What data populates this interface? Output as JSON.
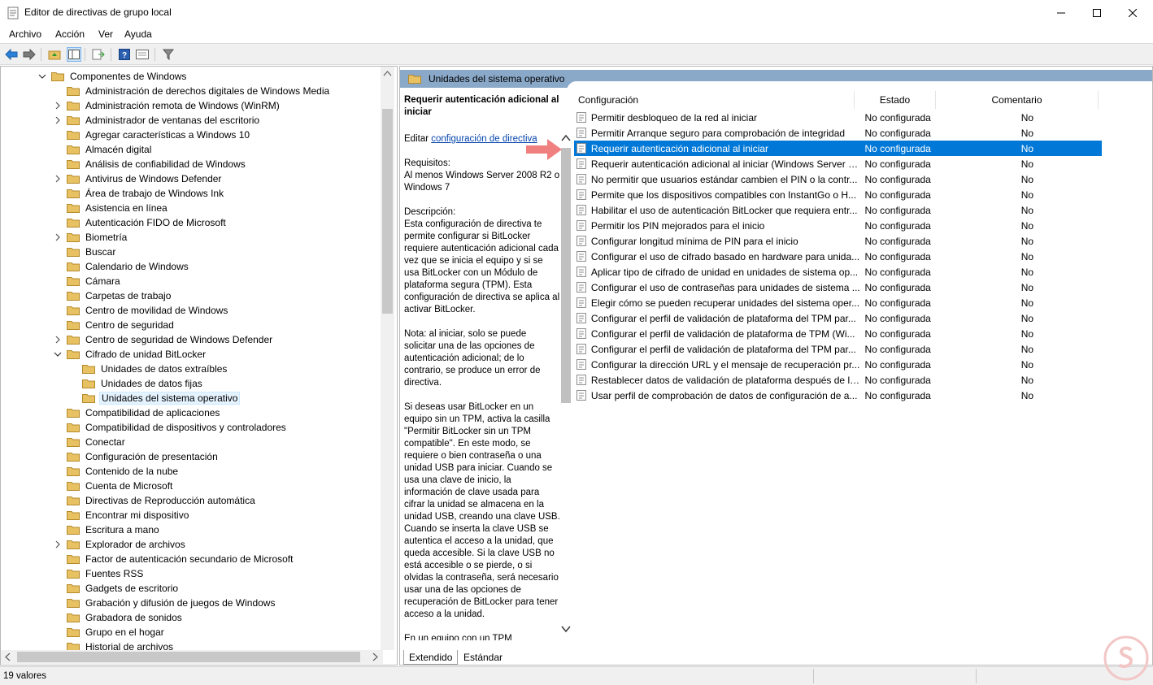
{
  "window": {
    "title": "Editor de directivas de grupo local"
  },
  "menu": [
    "Archivo",
    "Acción",
    "Ver",
    "Ayuda"
  ],
  "tree": {
    "root": "Componentes de Windows",
    "items": [
      {
        "label": "Administración de derechos digitales de Windows Media",
        "expander": ""
      },
      {
        "label": "Administración remota de Windows (WinRM)",
        "expander": "collapsed"
      },
      {
        "label": "Administrador de ventanas del escritorio",
        "expander": "collapsed"
      },
      {
        "label": "Agregar características a Windows 10",
        "expander": ""
      },
      {
        "label": "Almacén digital",
        "expander": ""
      },
      {
        "label": "Análisis de confiabilidad de Windows",
        "expander": ""
      },
      {
        "label": "Antivirus de Windows Defender",
        "expander": "collapsed"
      },
      {
        "label": "Área de trabajo de Windows Ink",
        "expander": ""
      },
      {
        "label": "Asistencia en línea",
        "expander": ""
      },
      {
        "label": "Autenticación FIDO de Microsoft",
        "expander": ""
      },
      {
        "label": "Biometría",
        "expander": "collapsed"
      },
      {
        "label": "Buscar",
        "expander": ""
      },
      {
        "label": "Calendario de Windows",
        "expander": ""
      },
      {
        "label": "Cámara",
        "expander": ""
      },
      {
        "label": "Carpetas de trabajo",
        "expander": ""
      },
      {
        "label": "Centro de movilidad de Windows",
        "expander": ""
      },
      {
        "label": "Centro de seguridad",
        "expander": ""
      },
      {
        "label": "Centro de seguridad de Windows Defender",
        "expander": "collapsed"
      },
      {
        "label": "Cifrado de unidad BitLocker",
        "expander": "expanded"
      },
      {
        "label": "Unidades de datos extraíbles",
        "expander": "",
        "child": true
      },
      {
        "label": "Unidades de datos fijas",
        "expander": "",
        "child": true
      },
      {
        "label": "Unidades del sistema operativo",
        "expander": "",
        "child": true,
        "selected": true
      },
      {
        "label": "Compatibilidad de aplicaciones",
        "expander": ""
      },
      {
        "label": "Compatibilidad de dispositivos y controladores",
        "expander": ""
      },
      {
        "label": "Conectar",
        "expander": ""
      },
      {
        "label": "Configuración de presentación",
        "expander": ""
      },
      {
        "label": "Contenido de la nube",
        "expander": ""
      },
      {
        "label": "Cuenta de Microsoft",
        "expander": ""
      },
      {
        "label": "Directivas de Reproducción automática",
        "expander": ""
      },
      {
        "label": "Encontrar mi dispositivo",
        "expander": ""
      },
      {
        "label": "Escritura a mano",
        "expander": ""
      },
      {
        "label": "Explorador de archivos",
        "expander": "collapsed"
      },
      {
        "label": "Factor de autenticación secundario de Microsoft",
        "expander": ""
      },
      {
        "label": "Fuentes RSS",
        "expander": ""
      },
      {
        "label": "Gadgets de escritorio",
        "expander": ""
      },
      {
        "label": "Grabación y difusión de juegos de Windows",
        "expander": ""
      },
      {
        "label": "Grabadora de sonidos",
        "expander": ""
      },
      {
        "label": "Grupo en el hogar",
        "expander": ""
      },
      {
        "label": "Historial de archivos",
        "expander": ""
      }
    ]
  },
  "right": {
    "header": "Unidades del sistema operativo",
    "description": {
      "title": "Requerir autenticación adicional al iniciar",
      "edit_prefix": "Editar ",
      "edit_link": "configuración de directiva",
      "requirements": "Requisitos:\nAl menos Windows Server 2008 R2 o Windows 7",
      "description": "Descripción:\nEsta configuración de directiva te permite configurar si BitLocker requiere autenticación adicional cada vez que se inicia el equipo y si se usa BitLocker con un Módulo de plataforma segura (TPM). Esta configuración de directiva se aplica al activar BitLocker.",
      "note": "Nota: al iniciar, solo se puede solicitar una de las opciones de autenticación adicional; de lo contrario, se produce un error de directiva.",
      "usb": "Si deseas usar BitLocker en un equipo sin un TPM, activa la casilla \"Permitir BitLocker sin un TPM compatible\". En este modo, se requiere o bien contraseña o una unidad USB para iniciar. Cuando se usa una clave de inicio, la información de clave usada para cifrar la unidad se almacena en la unidad USB, creando una clave USB. Cuando se inserta la clave USB se autentica el acceso a la unidad, que queda accesible. Si la clave USB no está accesible o se pierde, o si olvidas la contraseña, será necesario usar una de las opciones de recuperación de BitLocker para tener acceso a la unidad.",
      "tail": "En un equipo con un TPM"
    },
    "columns": [
      "Configuración",
      "Estado",
      "Comentario"
    ],
    "rows": [
      {
        "name": "Permitir desbloqueo de la red al iniciar",
        "state": "No configurada",
        "comment": "No"
      },
      {
        "name": "Permitir Arranque seguro para comprobación de integridad",
        "state": "No configurada",
        "comment": "No"
      },
      {
        "name": "Requerir autenticación adicional al iniciar",
        "state": "No configurada",
        "comment": "No",
        "selected": true
      },
      {
        "name": "Requerir autenticación adicional al iniciar (Windows Server 2...",
        "state": "No configurada",
        "comment": "No"
      },
      {
        "name": "No permitir que usuarios estándar cambien el PIN o la contr...",
        "state": "No configurada",
        "comment": "No"
      },
      {
        "name": "Permite que los dispositivos compatibles con InstantGo o H...",
        "state": "No configurada",
        "comment": "No"
      },
      {
        "name": "Habilitar el uso de autenticación BitLocker que requiera entr...",
        "state": "No configurada",
        "comment": "No"
      },
      {
        "name": "Permitir los PIN mejorados para el inicio",
        "state": "No configurada",
        "comment": "No"
      },
      {
        "name": "Configurar longitud mínima de PIN para el inicio",
        "state": "No configurada",
        "comment": "No"
      },
      {
        "name": "Configurar el uso de cifrado basado en hardware para unida...",
        "state": "No configurada",
        "comment": "No"
      },
      {
        "name": "Aplicar tipo de cifrado de unidad en unidades de sistema op...",
        "state": "No configurada",
        "comment": "No"
      },
      {
        "name": "Configurar el uso de contraseñas para unidades de sistema ...",
        "state": "No configurada",
        "comment": "No"
      },
      {
        "name": "Elegir cómo se pueden recuperar unidades del sistema oper...",
        "state": "No configurada",
        "comment": "No"
      },
      {
        "name": "Configurar el perfil de validación de plataforma del TPM par...",
        "state": "No configurada",
        "comment": "No"
      },
      {
        "name": "Configurar el perfil de validación de plataforma de TPM (Wi...",
        "state": "No configurada",
        "comment": "No"
      },
      {
        "name": "Configurar el perfil de validación de plataforma del TPM par...",
        "state": "No configurada",
        "comment": "No"
      },
      {
        "name": "Configurar la dirección URL y el mensaje de recuperación pr...",
        "state": "No configurada",
        "comment": "No"
      },
      {
        "name": "Restablecer datos de validación de plataforma después de la...",
        "state": "No configurada",
        "comment": "No"
      },
      {
        "name": "Usar perfil de comprobación de datos de configuración de a...",
        "state": "No configurada",
        "comment": "No"
      }
    ],
    "tabs": [
      "Extendido",
      "Estándar"
    ]
  },
  "status": {
    "text": "19 valores"
  },
  "colors": {
    "selection": "#0078d7",
    "header_band": "#8aa8c8",
    "folder": "#e8c163",
    "arrow": "#f08080"
  }
}
